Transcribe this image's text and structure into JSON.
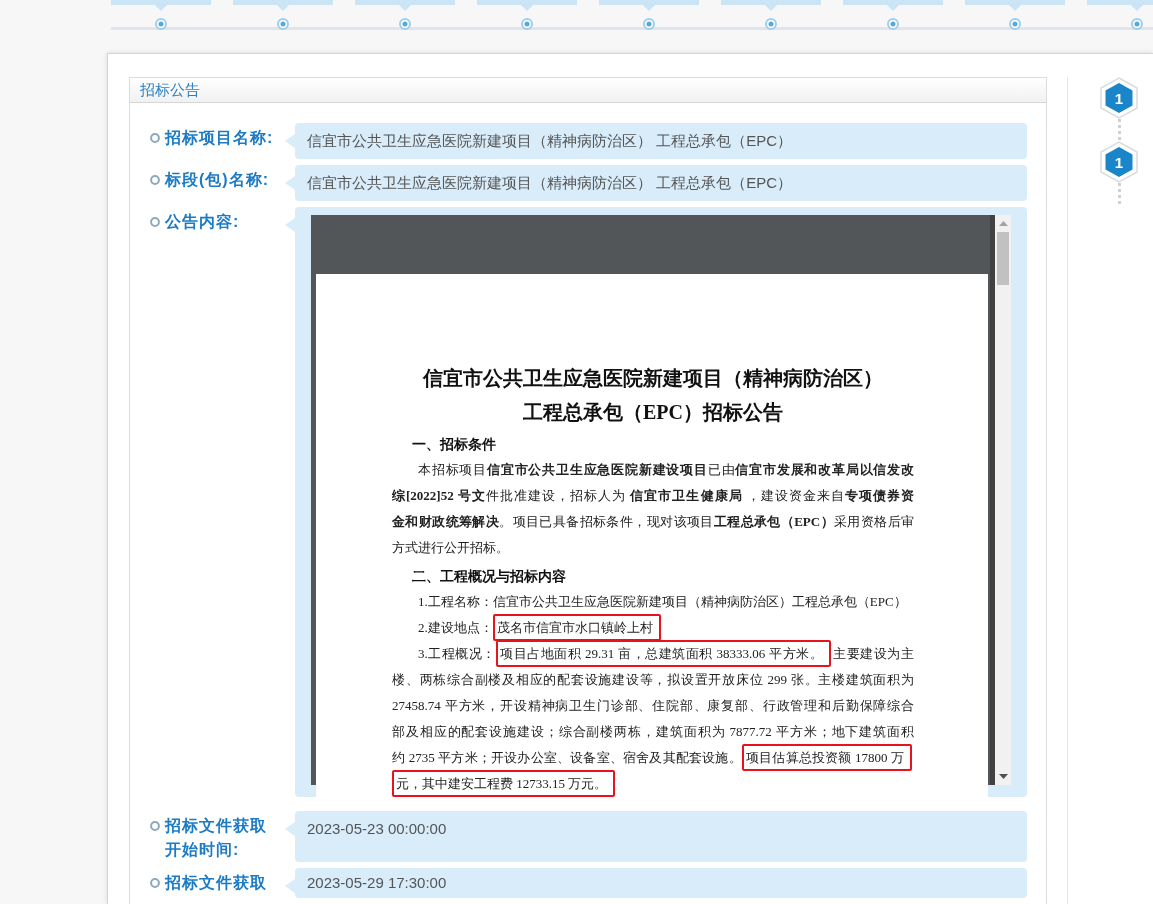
{
  "notice": {
    "title": "招标公告"
  },
  "fields": [
    {
      "kind": "text",
      "label": "招标项目名称:",
      "value": "信宜市公共卫生应急医院新建项目（精神病防治区） 工程总承包（EPC）"
    },
    {
      "kind": "text",
      "label": "标段(包)名称:",
      "value": "信宜市公共卫生应急医院新建项目（精神病防治区） 工程总承包（EPC）"
    },
    {
      "kind": "document",
      "label": "公告内容:",
      "document": {
        "title": "信宜市公共卫生应急医院新建项目（精神病防治区）工程总承包（EPC）招标公告",
        "sections": [
          {
            "heading": "一、招标条件",
            "paragraphs": [
              {
                "lines": [
                  [
                    {
                      "text": "本招标项目**信宜市公共卫生应急医院新建设项目**已由**信宜市发展和改革局以信发改**",
                      "framed": false
                    }
                  ],
                  [
                    {
                      "text": "**综[2022]52 号文**件批准建设，招标人为 **信宜市卫生健康局** ，建设资金来自**专项债券资**",
                      "framed": false
                    }
                  ],
                  [
                    {
                      "text": "**金和财政统筹解决**。项目已具备招标条件，现对该项目**工程总承包（EPC）**采用资格后审",
                      "framed": false
                    }
                  ],
                  [
                    {
                      "text": "方式进行公开招标。",
                      "framed": false
                    }
                  ]
                ]
              }
            ]
          },
          {
            "heading": "二、工程概况与招标内容",
            "paragraphs": [
              {
                "lines": [
                  [
                    {
                      "text": "1.工程名称：信宜市公共卫生应急医院新建项目（精神病防治区）工程总承包（EPC）",
                      "framed": false
                    }
                  ]
                ]
              },
              {
                "lines": [
                  [
                    {
                      "text": "2.建设地点：",
                      "framed": false
                    },
                    {
                      "text": "茂名市信宜市水口镇岭上村",
                      "framed": true
                    }
                  ]
                ]
              },
              {
                "lines": [
                  [
                    {
                      "text": "3.工程概况：",
                      "framed": false
                    },
                    {
                      "text": "项目占地面积 29.31 亩，总建筑面积 38333.06 平方米。",
                      "framed": true
                    },
                    {
                      "text": "主要建设为主",
                      "framed": false
                    }
                  ],
                  [
                    {
                      "text": "楼、两栋综合副楼及相应的配套设施建设等，拟设置开放床位 299 张。主楼建筑面积为",
                      "framed": false
                    }
                  ],
                  [
                    {
                      "text": "27458.74 平方米，开设精神病卫生门诊部、住院部、康复部、行政管理和后勤保障综合",
                      "framed": false
                    }
                  ],
                  [
                    {
                      "text": "部及相应的配套设施建设；综合副楼两栋，建筑面积为 7877.72 平方米；地下建筑面积",
                      "framed": false
                    }
                  ],
                  [
                    {
                      "text": "约 2735 平方米；开设办公室、设备室、宿舍及其配套设施。",
                      "framed": false
                    },
                    {
                      "text": "项目估算总投资额 17800 万",
                      "framed": true
                    }
                  ],
                  [
                    {
                      "text": "元，其中建安工程费 12733.15 万元。",
                      "framed": true
                    }
                  ]
                ]
              }
            ]
          }
        ]
      }
    },
    {
      "kind": "text",
      "label": "招标文件获取开始时间:",
      "value": "2023-05-23 00:00:00"
    },
    {
      "kind": "text",
      "label": "招标文件获取",
      "value": "2023-05-29 17:30:00"
    }
  ],
  "steps": [
    {
      "number": "1"
    },
    {
      "number": "1"
    }
  ]
}
